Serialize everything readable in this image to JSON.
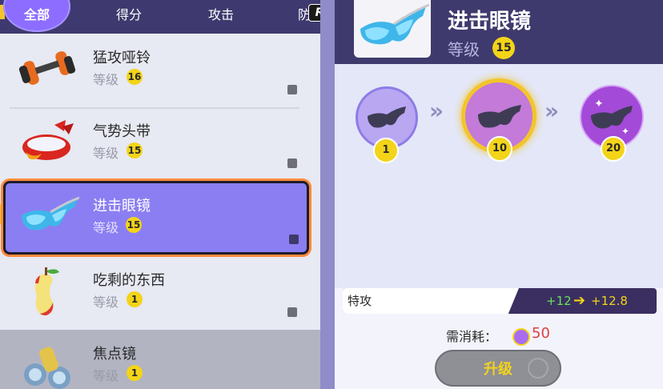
{
  "tabs": {
    "all": "全部",
    "score": "得分",
    "attack": "攻击",
    "defense_partial": "防",
    "r_badge": "R"
  },
  "items": [
    {
      "name": "猛攻哑铃",
      "level_label": "等级",
      "level": "16",
      "icon": "dumbbell-icon"
    },
    {
      "name": "气势头带",
      "level_label": "等级",
      "level": "15",
      "icon": "headband-icon"
    },
    {
      "name": "进击眼镜",
      "level_label": "等级",
      "level": "15",
      "icon": "goggles-icon",
      "selected": true
    },
    {
      "name": "吃剩的东西",
      "level_label": "等级",
      "level": "1",
      "icon": "apple-core-icon"
    },
    {
      "name": "焦点镜",
      "level_label": "等级",
      "level": "1",
      "icon": "scope-lens-icon"
    }
  ],
  "detail": {
    "title": "进击眼镜",
    "level_label": "等级",
    "level": "15",
    "stages": [
      "1",
      "10",
      "20"
    ],
    "stat": {
      "name": "特攻",
      "from": "+12",
      "to": "+12.8"
    },
    "cost_label": "需消耗：",
    "cost_value": "50",
    "upgrade_button": "升级"
  },
  "colors": {
    "accent": "#8b7ef2",
    "header": "#3f3a6d",
    "badge": "#f3d419",
    "cost": "#e04040",
    "stat_gain": "#68e05a"
  }
}
